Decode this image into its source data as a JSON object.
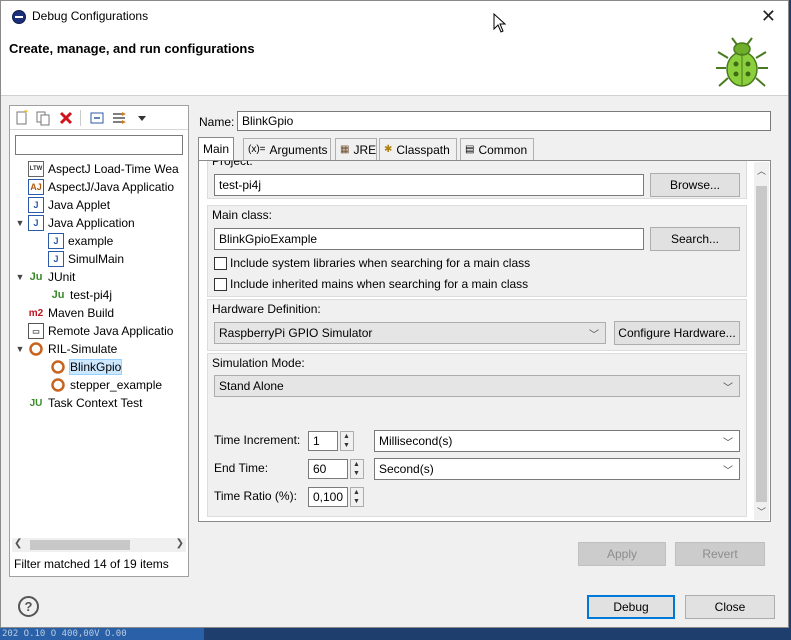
{
  "window": {
    "title": "Debug Configurations",
    "close_glyph": "✕",
    "banner_title": "Create, manage, and run configurations"
  },
  "left_panel": {
    "toolbar_icons": [
      "new-config-icon",
      "duplicate-icon",
      "delete-icon",
      "collapse-all-icon",
      "filter-icon",
      "dropdown-icon"
    ],
    "filter_placeholder": "",
    "tree": [
      {
        "label": "AspectJ Load-Time Wea",
        "icon": "ltw-icon",
        "level": 1
      },
      {
        "label": "AspectJ/Java Applicatio",
        "icon": "aj-icon",
        "level": 1
      },
      {
        "label": "Java Applet",
        "icon": "java-applet-icon",
        "level": 1
      },
      {
        "label": "Java Application",
        "icon": "java-app-icon",
        "level": 1,
        "expanded": true
      },
      {
        "label": "example",
        "icon": "java-app-icon",
        "level": 2
      },
      {
        "label": "SimulMain",
        "icon": "java-app-icon",
        "level": 2
      },
      {
        "label": "JUnit",
        "icon": "junit-icon",
        "level": 1,
        "expanded": true
      },
      {
        "label": "test-pi4j",
        "icon": "junit-icon",
        "level": 2
      },
      {
        "label": "Maven Build",
        "icon": "m2-icon",
        "level": 1
      },
      {
        "label": "Remote Java Applicatio",
        "icon": "remote-java-icon",
        "level": 1
      },
      {
        "label": "RIL-Simulate",
        "icon": "ril-icon",
        "level": 1,
        "expanded": true
      },
      {
        "label": "BlinkGpio",
        "icon": "ril-icon",
        "level": 2,
        "selected": true
      },
      {
        "label": "stepper_example",
        "icon": "ril-icon",
        "level": 2
      },
      {
        "label": "Task Context Test",
        "icon": "junit-task-icon",
        "level": 1
      }
    ],
    "filter_status": "Filter matched 14 of 19 items"
  },
  "config": {
    "name_label": "Name:",
    "name_value": "BlinkGpio",
    "tabs": [
      {
        "label": "Main",
        "icon": "",
        "active": true
      },
      {
        "label": "Arguments",
        "icon": "(x)="
      },
      {
        "label": "JRE",
        "icon": "▦"
      },
      {
        "label": "Classpath",
        "icon": "✱"
      },
      {
        "label": "Common",
        "icon": "▤"
      }
    ],
    "project": {
      "label": "Project:",
      "value": "test-pi4j",
      "browse_label": "Browse..."
    },
    "main_class": {
      "label": "Main class:",
      "value": "BlinkGpioExample",
      "search_label": "Search...",
      "include_system_libs": "Include system libraries when searching for a main class",
      "include_inherited": "Include inherited mains when searching for a main class"
    },
    "hardware": {
      "label": "Hardware Definition:",
      "selected": "RaspberryPi GPIO Simulator",
      "configure_label": "Configure Hardware..."
    },
    "simulation": {
      "label": "Simulation Mode:",
      "mode": "Stand Alone",
      "time_increment_label": "Time Increment:",
      "time_increment_value": "1",
      "time_increment_unit": "Millisecond(s)",
      "end_time_label": "End Time:",
      "end_time_value": "60",
      "end_time_unit": "Second(s)",
      "time_ratio_label": "Time Ratio (%):",
      "time_ratio_value": "0,100"
    },
    "apply_label": "Apply",
    "revert_label": "Revert"
  },
  "footer": {
    "help_glyph": "?",
    "debug_label": "Debug",
    "close_label": "Close"
  },
  "background_strip": "202 O.10 O 400,00V O.00"
}
